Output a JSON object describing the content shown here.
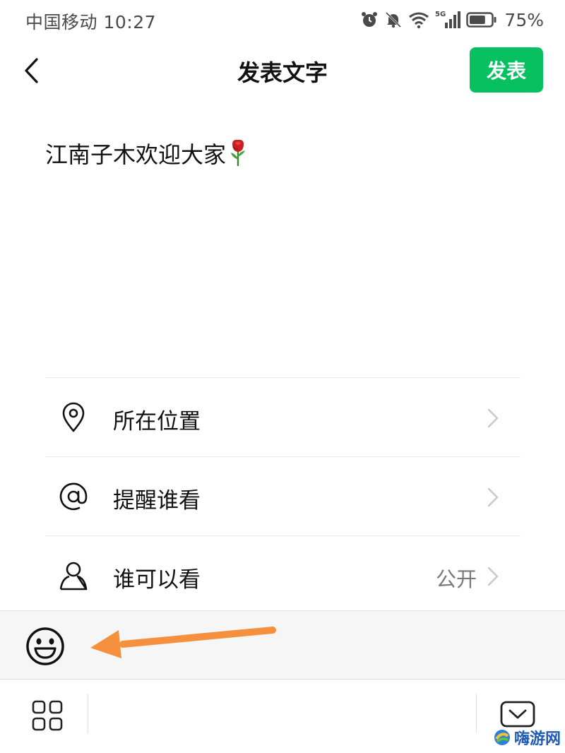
{
  "status_bar": {
    "carrier": "中国移动",
    "time": "10:27",
    "network": "5G",
    "battery_percent": "75%",
    "icons": [
      "alarm-icon",
      "mute-bell-icon",
      "wifi-icon",
      "signal-icon",
      "battery-icon"
    ]
  },
  "nav": {
    "back_icon": "chevron-left-icon",
    "title": "发表文字",
    "post_label": "发表"
  },
  "composer": {
    "text": "江南子木欢迎大家",
    "emoji_icon": "rose-icon"
  },
  "options": [
    {
      "label": "所在位置",
      "value": "",
      "icon": "location-pin-icon"
    },
    {
      "label": "提醒谁看",
      "value": "",
      "icon": "at-sign-icon"
    },
    {
      "label": "谁可以看",
      "value": "公开",
      "icon": "person-icon"
    }
  ],
  "emoji_bar": {
    "icon": "smiley-face-icon"
  },
  "keyboard_bar": {
    "apps_icon": "grid-apps-icon",
    "hide_icon": "keyboard-hide-icon"
  },
  "watermark": {
    "text": "嗨游网"
  },
  "colors": {
    "accent_green": "#07c160",
    "annotation_orange": "#f5903e",
    "secondary_text": "#7a7a7a",
    "divider": "#ececec",
    "toolbar_bg": "#f6f6f6"
  }
}
